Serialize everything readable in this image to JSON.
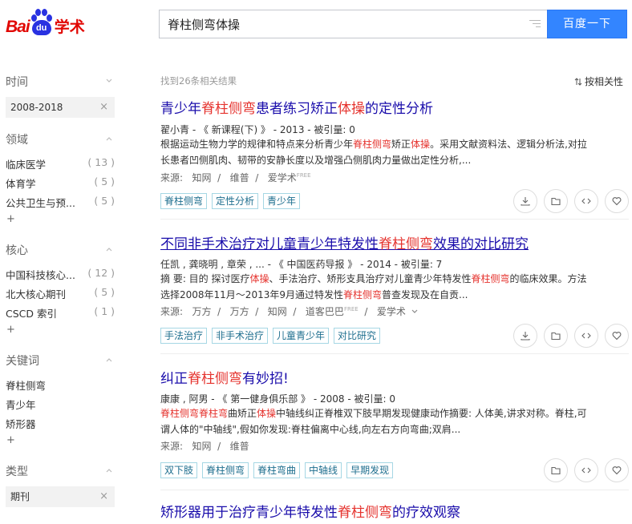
{
  "logo": {
    "bai": "Bai",
    "du": "du",
    "xueshu": "学术"
  },
  "search": {
    "query": "脊柱侧弯体操",
    "button": "百度一下"
  },
  "sidebar": {
    "time": {
      "label": "时间",
      "chip": "2008-2018",
      "clear": "×"
    },
    "field": {
      "label": "领域",
      "items": [
        {
          "name": "临床医学",
          "count": "( 13 )"
        },
        {
          "name": "体育学",
          "count": "( 5 )"
        },
        {
          "name": "公共卫生与预...",
          "count": "( 5 )"
        }
      ],
      "more": "+"
    },
    "core": {
      "label": "核心",
      "items": [
        {
          "name": "中国科技核心...",
          "count": "( 12 )"
        },
        {
          "name": "北大核心期刊",
          "count": "( 5 )"
        },
        {
          "name": "CSCD 索引",
          "count": "( 1 )"
        }
      ],
      "more": "+"
    },
    "keywords": {
      "label": "关键词",
      "items": [
        {
          "name": "脊柱侧弯"
        },
        {
          "name": "青少年"
        },
        {
          "name": "矫形器"
        }
      ],
      "more": "+"
    },
    "type": {
      "label": "类型",
      "chip": "期刊",
      "clear": "×"
    }
  },
  "results_header": {
    "found": "找到26条相关结果",
    "sort": "按相关性"
  },
  "results": [
    {
      "title_parts": [
        "青少年",
        "脊柱侧弯",
        "患者练习矫正",
        "体操",
        "的定性分析"
      ],
      "meta": "翟小青  -  《 新课程(下) 》  -  2013  -  被引量:  0",
      "abs1": [
        "根据运动生物力学的规律和特点来分析青少年",
        "脊柱侧弯",
        "矫正",
        "体操",
        "。采用文献资料法、逻辑分析法,对拉"
      ],
      "abs2": "长患者凹侧肌肉、韧带的安静长度以及增强凸侧肌肉力量做出定性分析,...",
      "source": [
        "来源:",
        "知网",
        "维普",
        "爱学术"
      ],
      "free": "FREE",
      "tags": [
        "脊柱侧弯",
        "定性分析",
        "青少年"
      ]
    },
    {
      "title_parts": [
        "不同非手术治疗对儿童青少年特发性",
        "脊柱侧弯",
        "效果的对比研究"
      ],
      "meta": "任凯 ,  龚晓明 ,  章荣 ,  ... -  《 中国医药导报 》  -  2014  -  被引量:  7",
      "abs1": [
        "摘    要: 目的 探讨医疗",
        "体操",
        "、手法治疗、矫形支具治疗对儿童青少年特发性",
        "脊柱侧弯",
        "的临床效果。方法"
      ],
      "abs2_parts": [
        "选择2008年11月～2013年9月通过特发性",
        "脊柱侧弯",
        "普查发现及在自贡..."
      ],
      "source": [
        "来源:",
        "万方",
        "万方",
        "知网",
        "道客巴巴",
        "爱学术"
      ],
      "free": "FREE",
      "tags": [
        "手法治疗",
        "非手术治疗",
        "儿童青少年",
        "对比研究"
      ]
    },
    {
      "title_parts": [
        "纠正",
        "脊柱侧弯",
        "有妙招!"
      ],
      "meta": "康康 ,  阿男  -  《 第一健身俱乐部 》  -  2008  -  被引量:  0",
      "abs1": [
        "脊柱侧弯脊柱弯",
        "曲矫正",
        "体操",
        "中轴线纠正脊椎双下肢早期发现健康动作摘要: 人体美,讲求对称。脊柱,可"
      ],
      "abs2": "谓人体的\"中轴线\",假如你发现:脊柱偏离中心线,向左右方向弯曲;双肩...",
      "source": [
        "来源:",
        "知网",
        "维普"
      ],
      "tags": [
        "双下肢",
        "脊柱侧弯",
        "脊柱弯曲",
        "中轴线",
        "早期发现"
      ]
    },
    {
      "title_parts": [
        "矫形器用于治疗青少年特发性",
        "脊柱侧弯",
        "的疗效观察"
      ]
    }
  ]
}
